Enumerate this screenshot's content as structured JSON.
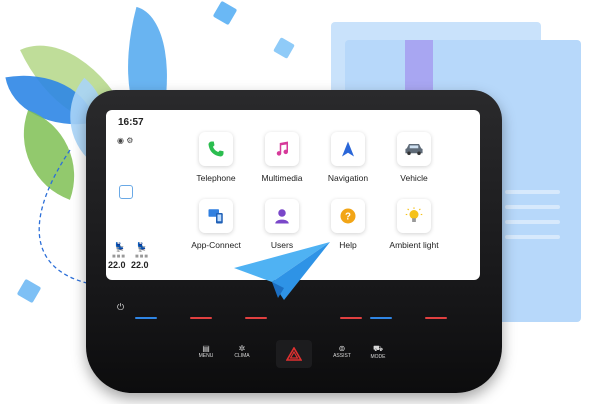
{
  "status": {
    "time": "16:57",
    "icons": "◉ ⚙"
  },
  "climate": {
    "left_temp": "22.0",
    "right_temp": "22.0"
  },
  "apps": [
    {
      "label": "Telephone",
      "icon": "phone-icon",
      "color": "#2bbd4f"
    },
    {
      "label": "Multimedia",
      "icon": "music-note-icon",
      "color": "#d63a9a"
    },
    {
      "label": "Navigation",
      "icon": "navigation-arrow-icon",
      "color": "#2a66d8"
    },
    {
      "label": "Vehicle",
      "icon": "car-icon",
      "color": "#5f6b78"
    },
    {
      "label": "App-Connect",
      "icon": "app-connect-icon",
      "color": "#2f7fe0"
    },
    {
      "label": "Users",
      "icon": "user-icon",
      "color": "#7a47c9"
    },
    {
      "label": "Help",
      "icon": "help-icon",
      "color": "#f2a516"
    },
    {
      "label": "Ambient light",
      "icon": "lightbulb-icon",
      "color": "#f6c21a"
    }
  ],
  "controls": {
    "menu": "MENU",
    "clima": "CLIMA",
    "assist": "ASSIST",
    "mode": "MODE"
  }
}
